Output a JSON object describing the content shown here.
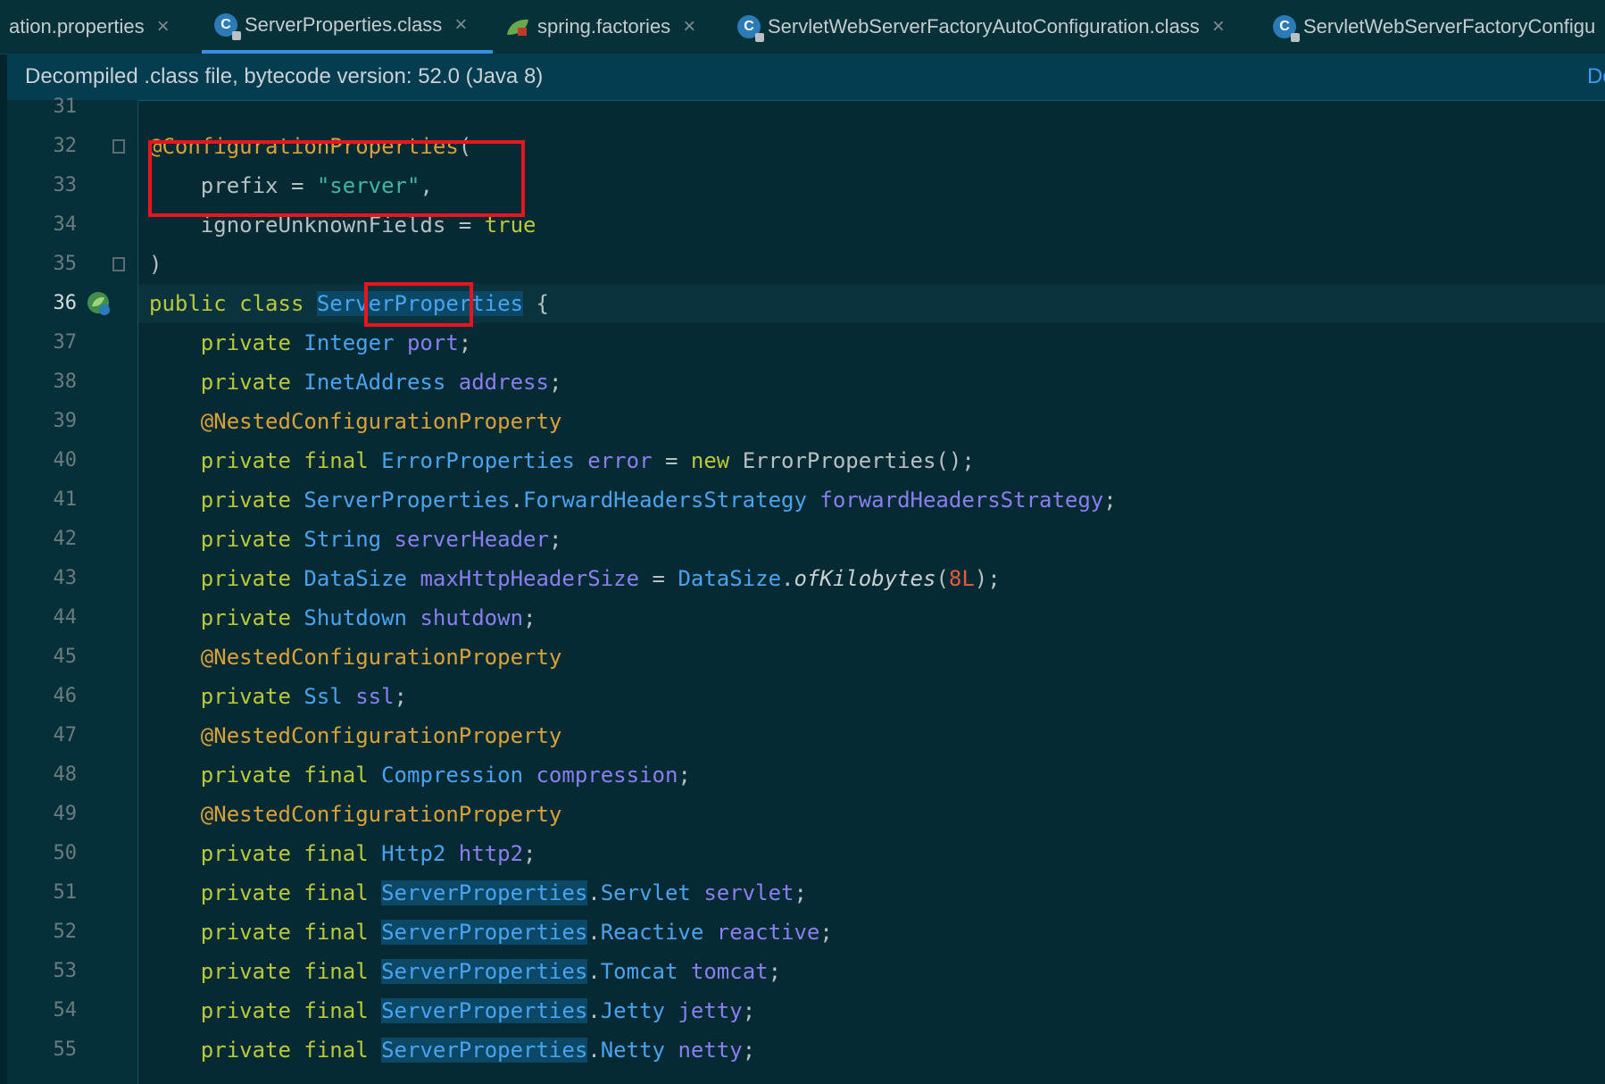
{
  "tabs": [
    {
      "label": "ation.properties",
      "icon": "properties-icon",
      "active": false
    },
    {
      "label": "ServerProperties.class",
      "icon": "class-icon",
      "active": true
    },
    {
      "label": "spring.factories",
      "icon": "spring-leaf-icon",
      "active": false
    },
    {
      "label": "ServletWebServerFactoryAutoConfiguration.class",
      "icon": "class-icon",
      "active": false
    },
    {
      "label": "ServletWebServerFactoryConfigu",
      "icon": "class-icon",
      "active": false
    }
  ],
  "close_glyph": "×",
  "banner": {
    "text": "Decompiled .class file, bytecode version: 52.0 (Java 8)",
    "link": "Downlo"
  },
  "colors": {
    "background": "#062a33",
    "keyword": "#b9c93a",
    "annotation": "#d8a23a",
    "string": "#3fb7a0",
    "type": "#4aa3f0",
    "field": "#8a7ef0",
    "number": "#e45a3a",
    "highlight_box": "#e8141e"
  },
  "code": {
    "current_line": 36,
    "lines": [
      {
        "n": "31",
        "tokens": []
      },
      {
        "n": "32",
        "tokens": [
          [
            "ann",
            "@ConfigurationProperties"
          ],
          [
            "pl",
            "("
          ]
        ]
      },
      {
        "n": "33",
        "tokens": [
          [
            "pl",
            "    prefix = "
          ],
          [
            "str",
            "\"server\""
          ],
          [
            "pl",
            ","
          ]
        ]
      },
      {
        "n": "34",
        "tokens": [
          [
            "pl",
            "    ignoreUnknownFields = "
          ],
          [
            "kw",
            "true"
          ]
        ]
      },
      {
        "n": "35",
        "tokens": [
          [
            "pl",
            ")"
          ]
        ]
      },
      {
        "n": "36",
        "tokens": [
          [
            "kw",
            "public class "
          ],
          [
            "typ sel",
            "ServerProperties"
          ],
          [
            "pl",
            " {"
          ]
        ]
      },
      {
        "n": "37",
        "tokens": [
          [
            "kw",
            "    private "
          ],
          [
            "typ",
            "Integer "
          ],
          [
            "fld",
            "port"
          ],
          [
            "pl",
            ";"
          ]
        ]
      },
      {
        "n": "38",
        "tokens": [
          [
            "kw",
            "    private "
          ],
          [
            "typ",
            "InetAddress "
          ],
          [
            "fld",
            "address"
          ],
          [
            "pl",
            ";"
          ]
        ]
      },
      {
        "n": "39",
        "tokens": [
          [
            "ann",
            "    @NestedConfigurationProperty"
          ]
        ]
      },
      {
        "n": "40",
        "tokens": [
          [
            "kw",
            "    private final "
          ],
          [
            "typ",
            "ErrorProperties "
          ],
          [
            "fld",
            "error"
          ],
          [
            "pl",
            " = "
          ],
          [
            "kw",
            "new "
          ],
          [
            "pl",
            "ErrorProperties();"
          ]
        ]
      },
      {
        "n": "41",
        "tokens": [
          [
            "kw",
            "    private "
          ],
          [
            "typ",
            "ServerProperties"
          ],
          [
            "pl",
            "."
          ],
          [
            "typ",
            "ForwardHeadersStrategy "
          ],
          [
            "fld",
            "forwardHeadersStrategy"
          ],
          [
            "pl",
            ";"
          ]
        ]
      },
      {
        "n": "42",
        "tokens": [
          [
            "kw",
            "    private "
          ],
          [
            "typ",
            "String "
          ],
          [
            "fld",
            "serverHeader"
          ],
          [
            "pl",
            ";"
          ]
        ]
      },
      {
        "n": "43",
        "tokens": [
          [
            "kw",
            "    private "
          ],
          [
            "typ",
            "DataSize "
          ],
          [
            "fld",
            "maxHttpHeaderSize"
          ],
          [
            "pl",
            " = "
          ],
          [
            "typ",
            "DataSize"
          ],
          [
            "pl",
            "."
          ],
          [
            "meth",
            "ofKilobytes"
          ],
          [
            "pl",
            "("
          ],
          [
            "num",
            "8L"
          ],
          [
            "pl",
            ");"
          ]
        ]
      },
      {
        "n": "44",
        "tokens": [
          [
            "kw",
            "    private "
          ],
          [
            "typ",
            "Shutdown "
          ],
          [
            "fld",
            "shutdown"
          ],
          [
            "pl",
            ";"
          ]
        ]
      },
      {
        "n": "45",
        "tokens": [
          [
            "ann",
            "    @NestedConfigurationProperty"
          ]
        ]
      },
      {
        "n": "46",
        "tokens": [
          [
            "kw",
            "    private "
          ],
          [
            "typ",
            "Ssl "
          ],
          [
            "fld",
            "ssl"
          ],
          [
            "pl",
            ";"
          ]
        ]
      },
      {
        "n": "47",
        "tokens": [
          [
            "ann",
            "    @NestedConfigurationProperty"
          ]
        ]
      },
      {
        "n": "48",
        "tokens": [
          [
            "kw",
            "    private final "
          ],
          [
            "typ",
            "Compression "
          ],
          [
            "fld",
            "compression"
          ],
          [
            "pl",
            ";"
          ]
        ]
      },
      {
        "n": "49",
        "tokens": [
          [
            "ann",
            "    @NestedConfigurationProperty"
          ]
        ]
      },
      {
        "n": "50",
        "tokens": [
          [
            "kw",
            "    private final "
          ],
          [
            "typ",
            "Http2 "
          ],
          [
            "fld",
            "http2"
          ],
          [
            "pl",
            ";"
          ]
        ]
      },
      {
        "n": "51",
        "tokens": [
          [
            "kw",
            "    private final "
          ],
          [
            "typ sel",
            "ServerProperties"
          ],
          [
            "pl",
            "."
          ],
          [
            "typ",
            "Servlet "
          ],
          [
            "fld",
            "servlet"
          ],
          [
            "pl",
            ";"
          ]
        ]
      },
      {
        "n": "52",
        "tokens": [
          [
            "kw",
            "    private final "
          ],
          [
            "typ sel",
            "ServerProperties"
          ],
          [
            "pl",
            "."
          ],
          [
            "typ",
            "Reactive "
          ],
          [
            "fld",
            "reactive"
          ],
          [
            "pl",
            ";"
          ]
        ]
      },
      {
        "n": "53",
        "tokens": [
          [
            "kw",
            "    private final "
          ],
          [
            "typ sel",
            "ServerProperties"
          ],
          [
            "pl",
            "."
          ],
          [
            "typ",
            "Tomcat "
          ],
          [
            "fld",
            "tomcat"
          ],
          [
            "pl",
            ";"
          ]
        ]
      },
      {
        "n": "54",
        "tokens": [
          [
            "kw",
            "    private final "
          ],
          [
            "typ sel",
            "ServerProperties"
          ],
          [
            "pl",
            "."
          ],
          [
            "typ",
            "Jetty "
          ],
          [
            "fld",
            "jetty"
          ],
          [
            "pl",
            ";"
          ]
        ]
      },
      {
        "n": "55",
        "tokens": [
          [
            "kw",
            "    private final "
          ],
          [
            "typ sel",
            "ServerProperties"
          ],
          [
            "pl",
            "."
          ],
          [
            "typ",
            "Netty "
          ],
          [
            "fld",
            "netty"
          ],
          [
            "pl",
            ";"
          ]
        ]
      }
    ]
  }
}
